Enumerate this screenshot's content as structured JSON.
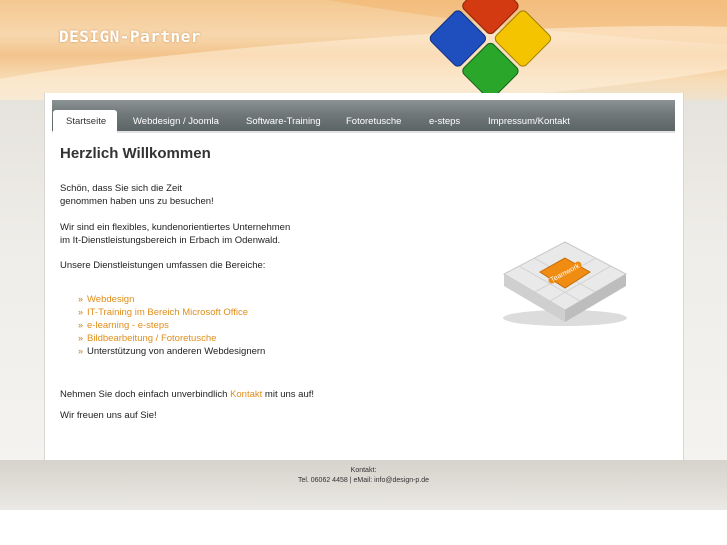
{
  "brand": {
    "name": "DESIGN-Partner"
  },
  "nav": {
    "items": [
      {
        "label": "Startseite"
      },
      {
        "label": "Webdesign / Joomla"
      },
      {
        "label": "Software-Training"
      },
      {
        "label": "Fotoretusche"
      },
      {
        "label": "e-steps"
      },
      {
        "label": "Impressum/Kontakt"
      }
    ],
    "active_index": 0
  },
  "main": {
    "title": "Herzlich Willkommen",
    "intro_line1": "Schön, dass Sie sich die Zeit",
    "intro_line2": "genommen haben uns zu besuchen!",
    "about_line1": "Wir sind ein flexibles, kundenorientiertes Unternehmen",
    "about_line2": "im It-Dienstleistungsbereich in Erbach im Odenwald.",
    "services_intro": "Unsere Dienstleistungen umfassen die Bereiche:",
    "services": [
      {
        "label": "Webdesign",
        "link": true
      },
      {
        "label": "IT-Training im Bereich Microsoft Office",
        "link": true
      },
      {
        "label": "e-learning - e-steps",
        "link": true
      },
      {
        "label": "Bildbearbeitung / Fotoretusche",
        "link": true
      },
      {
        "label": "Unterstützung von anderen Webdesignern",
        "link": false
      }
    ],
    "contact_pre": "Nehmen Sie doch einfach unverbindlich ",
    "contact_link": "Kontakt",
    "contact_post": " mit uns auf!",
    "closing": "Wir freuen uns auf Sie!",
    "image_label": "Teamwork"
  },
  "footer": {
    "label": "Kontakt:",
    "contact": "Tel. 06062 4458 | eMail: info@design-p.de"
  },
  "colors": {
    "accent": "#e08e1a",
    "nav": "#6b7374",
    "header": "#f4c890"
  }
}
